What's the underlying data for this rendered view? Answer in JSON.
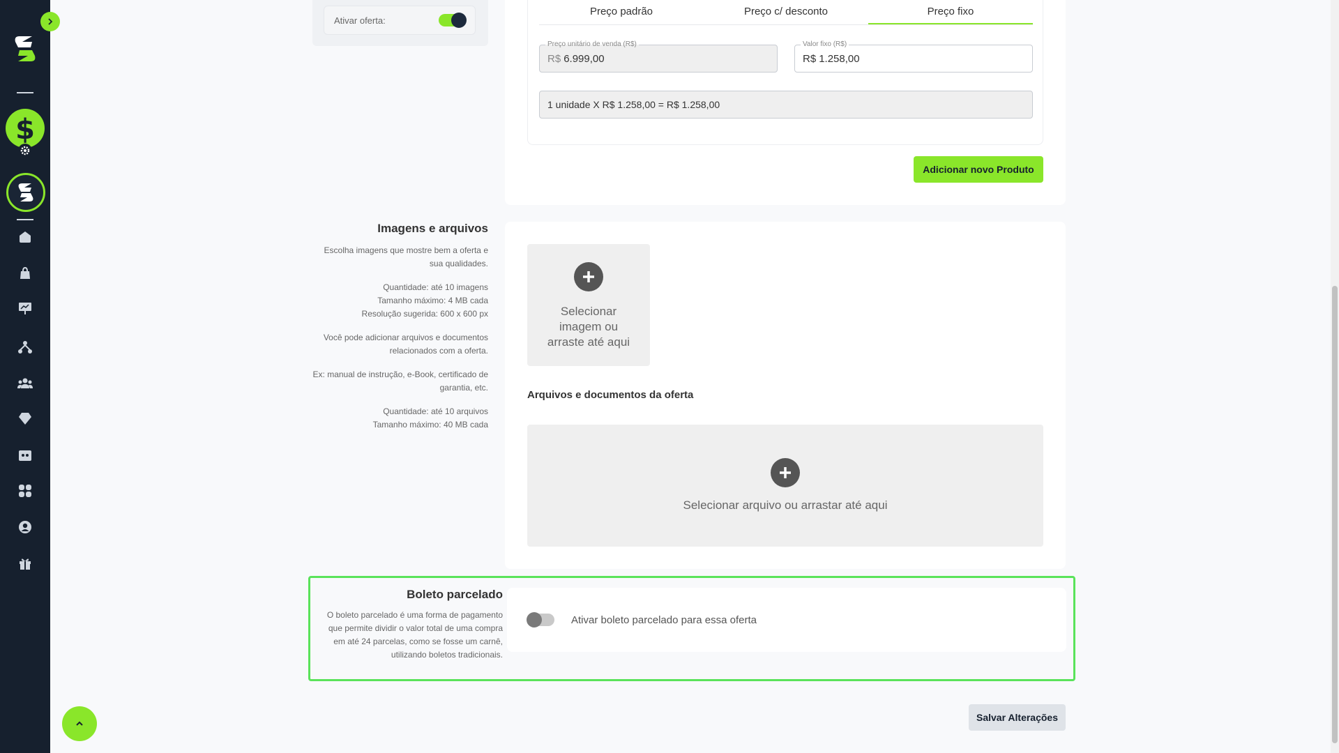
{
  "sidebar": {
    "expand_icon": "chevron-right-icon",
    "items": [
      {
        "icon": "home-icon"
      },
      {
        "icon": "shopping-bag-icon"
      },
      {
        "icon": "presentation-chart-icon"
      },
      {
        "icon": "network-icon"
      },
      {
        "icon": "users-icon"
      },
      {
        "icon": "diamond-icon"
      },
      {
        "icon": "wallet-icon"
      },
      {
        "icon": "apps-grid-icon"
      },
      {
        "icon": "user-circle-icon"
      },
      {
        "icon": "gift-icon"
      }
    ]
  },
  "offer_toggle": {
    "label": "Ativar oferta:",
    "enabled": true
  },
  "pricing": {
    "tabs": [
      {
        "label": "Preço padrão",
        "active": false
      },
      {
        "label": "Preço c/ desconto",
        "active": false
      },
      {
        "label": "Preço fixo",
        "active": true
      }
    ],
    "unit_price": {
      "legend": "Preço unitário de venda (R$)",
      "prefix": "R$",
      "value": "6.999,00"
    },
    "fixed_value": {
      "legend": "Valor fixo (R$)",
      "prefix": "R$",
      "value": "1.258,00"
    },
    "summary": "1 unidade X R$ 1.258,00 = R$ 1.258,00",
    "add_product_label": "Adicionar novo Produto"
  },
  "images_section": {
    "title": "Imagens e arquivos",
    "paragraphs": [
      "Escolha imagens que mostre bem a oferta e sua qualidades.",
      "Quantidade: até 10 imagens\nTamanho máximo: 4 MB cada\nResolução sugerida: 600 x 600 px",
      "Você pode adicionar arquivos e documentos relacionados com a oferta.",
      "Ex: manual de instrução, e-Book, certificado de garantia, etc.",
      "Quantidade: até 10 arquivos\nTamanho máximo: 40 MB cada"
    ],
    "image_drop_label": "Selecionar imagem ou arraste até aqui",
    "files_label": "Arquivos e documentos da oferta",
    "file_drop_label": "Selecionar arquivo ou arrastar até aqui"
  },
  "boleto": {
    "title": "Boleto parcelado",
    "description": "O boleto parcelado é uma forma de pagamento que permite dividir o valor total de uma compra em até 24 parcelas, como se fosse um carnê, utilizando boletos tradicionais.",
    "toggle_label": "Ativar boleto parcelado para essa oferta",
    "enabled": false
  },
  "save_label": "Salvar Alterações",
  "colors": {
    "accent": "#8ae62a",
    "sidebar": "#16202e",
    "highlight": "#5ae35a"
  }
}
